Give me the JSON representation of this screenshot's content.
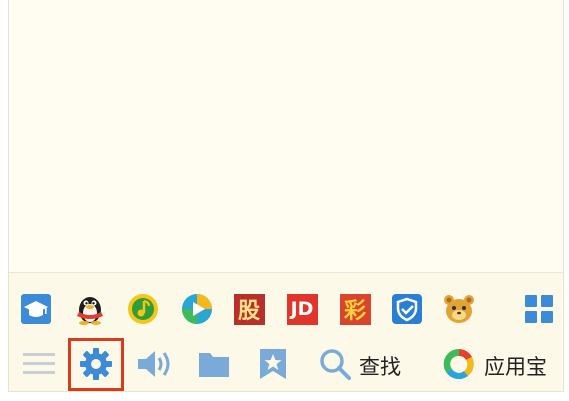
{
  "app_row": [
    {
      "name": "mortarboard-app-icon"
    },
    {
      "name": "qq-penguin-icon"
    },
    {
      "name": "qq-music-icon"
    },
    {
      "name": "video-player-icon"
    },
    {
      "name": "stock-app-icon",
      "text": "股"
    },
    {
      "name": "jd-app-icon",
      "text": "JD"
    },
    {
      "name": "lottery-app-icon",
      "text": "彩"
    },
    {
      "name": "security-shield-icon"
    },
    {
      "name": "pet-app-icon"
    },
    {
      "name": "app-grid-icon"
    }
  ],
  "toolbar": {
    "search_label": "查找",
    "appstore_label": "应用宝",
    "icons": [
      "menu-icon",
      "gear-icon",
      "volume-icon",
      "folder-icon",
      "star-icon",
      "search-icon",
      "app-store-icon"
    ]
  },
  "colors": {
    "accent_blue": "#3c8bd9",
    "highlight_red": "#d93c1a",
    "jd_red": "#e0352b",
    "stock_red": "#b8302a",
    "lottery_red": "#d8442c",
    "gray": "#c9cfd6"
  }
}
